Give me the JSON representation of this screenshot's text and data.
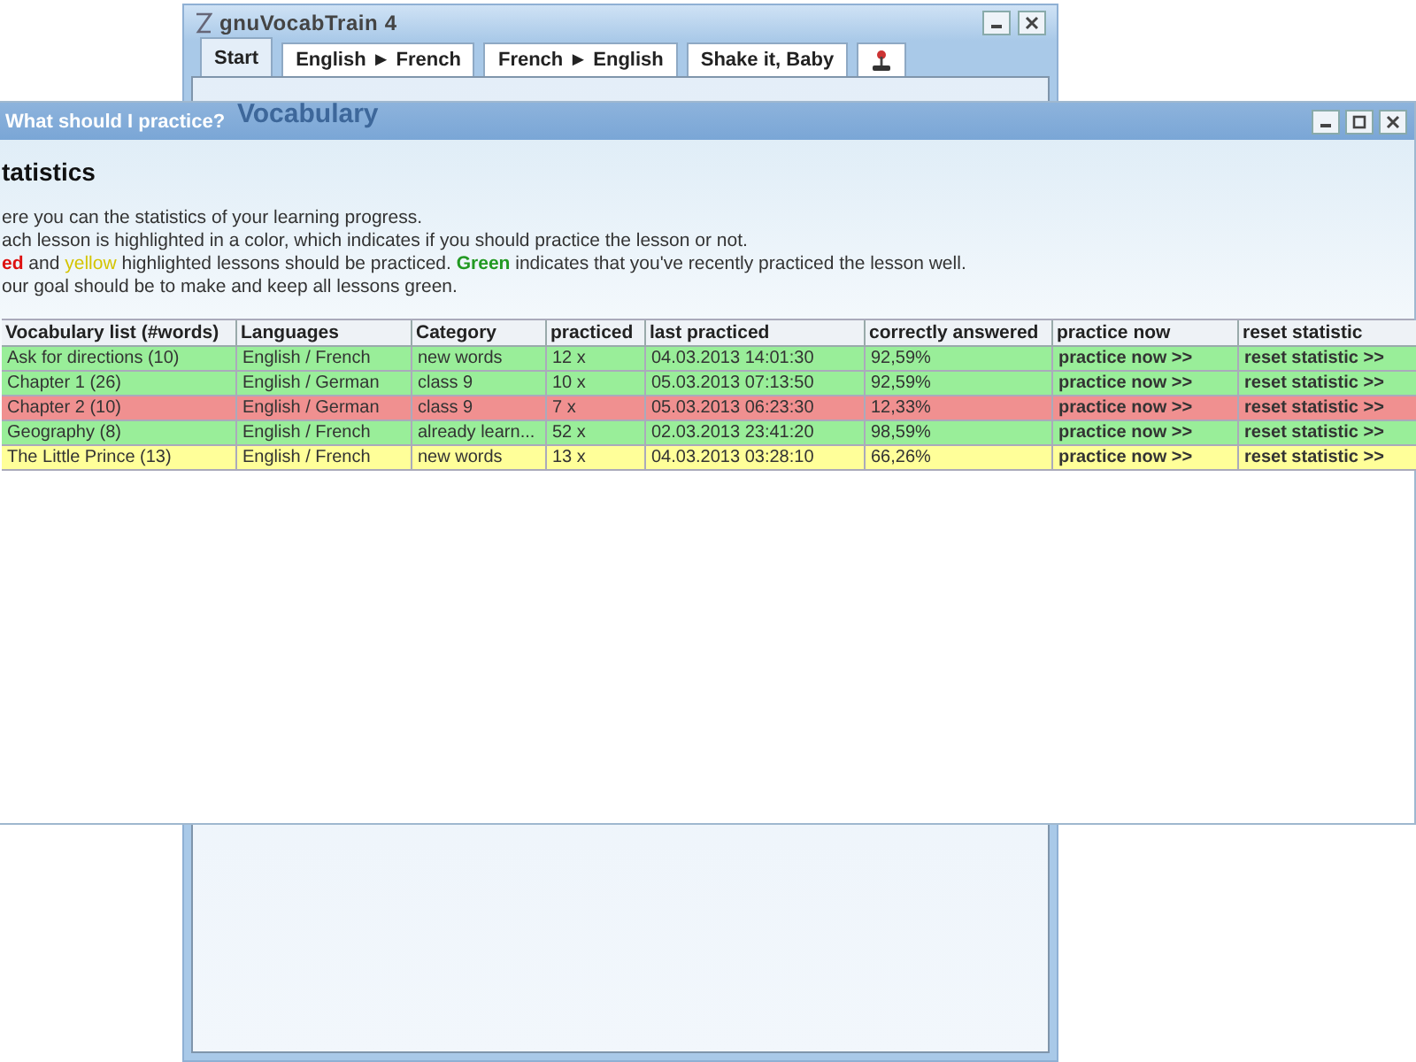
{
  "back_window": {
    "title": "gnuVocabTrain 4",
    "heading": "Vocabulary",
    "tabs": [
      {
        "kind": "text",
        "label": "Start",
        "selected": true
      },
      {
        "kind": "text",
        "label": "English ► French",
        "selected": false
      },
      {
        "kind": "text",
        "label": "French ► English",
        "selected": false
      },
      {
        "kind": "text",
        "label": "Shake it, Baby",
        "selected": false
      },
      {
        "kind": "icon",
        "selected": false
      }
    ]
  },
  "front_window": {
    "title": "What should I practice?",
    "heading": "tatistics",
    "paragraph": [
      [
        {
          "kind": "plain",
          "text": "ere you can the statistics of your learning progress."
        }
      ],
      [
        {
          "kind": "plain",
          "text": "ach lesson is highlighted in a color, which indicates if you should practice the lesson or not."
        }
      ],
      [
        {
          "kind": "red",
          "text": "ed"
        },
        {
          "kind": "plain",
          "text": " and "
        },
        {
          "kind": "yellow",
          "text": "yellow"
        },
        {
          "kind": "plain",
          "text": " highlighted lessons should be practiced. "
        },
        {
          "kind": "green",
          "text": "Green"
        },
        {
          "kind": "plain",
          "text": " indicates that you've recently practiced the lesson well."
        }
      ],
      [
        {
          "kind": "plain",
          "text": "our goal should be to make and keep all lessons green."
        }
      ]
    ],
    "table": {
      "columns": [
        "Vocabulary list (#words)",
        "Languages",
        "Category",
        "practiced",
        "last practiced",
        "correctly answered",
        "practice now",
        "reset statistic"
      ],
      "rows": [
        {
          "color": "#99ee99",
          "cells": [
            "Ask for directions (10)",
            "English / French",
            "new words",
            "12 x",
            "04.03.2013 14:01:30",
            "92,59%",
            "practice now >>",
            "reset statistic >>"
          ]
        },
        {
          "color": "#99ee99",
          "cells": [
            "Chapter 1 (26)",
            "English / German",
            "class 9",
            "10 x",
            "05.03.2013 07:13:50",
            "92,59%",
            "practice now >>",
            "reset statistic >>"
          ]
        },
        {
          "color": "#f09090",
          "cells": [
            "Chapter 2 (10)",
            "English / German",
            "class 9",
            "7 x",
            "05.03.2013 06:23:30",
            "12,33%",
            "practice now >>",
            "reset statistic >>"
          ]
        },
        {
          "color": "#99ee99",
          "cells": [
            "Geography (8)",
            "English / French",
            "already learn...",
            "52 x",
            "02.03.2013 23:41:20",
            "98,59%",
            "practice now >>",
            "reset statistic >>"
          ]
        },
        {
          "color": "#ffff99",
          "cells": [
            "The Little Prince (13)",
            "English / French",
            "new words",
            "13 x",
            "04.03.2013 03:28:10",
            "66,26%",
            "practice now >>",
            "reset statistic >>"
          ]
        }
      ]
    }
  }
}
